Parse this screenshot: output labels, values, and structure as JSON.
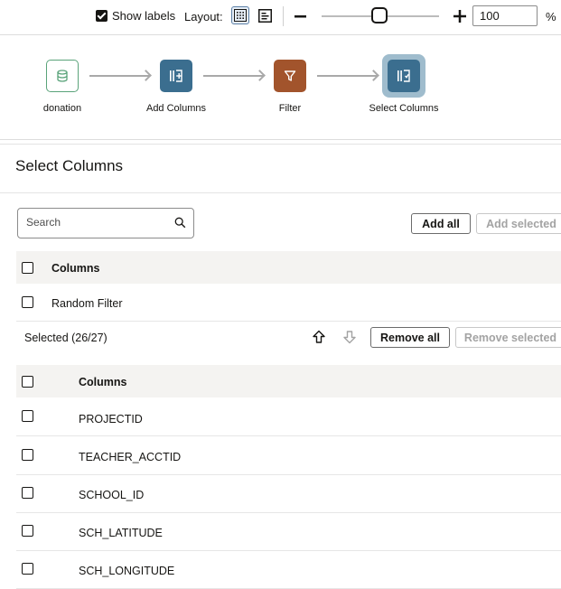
{
  "toolbar": {
    "show_labels": "Show labels",
    "show_labels_checked": true,
    "layout_label": "Layout:",
    "zoom_value": "100",
    "zoom_unit": "%",
    "zoom_minus_icon": "minus-icon",
    "zoom_plus_icon": "plus-icon"
  },
  "flow": {
    "nodes": [
      {
        "label": "donation",
        "icon": "database-icon",
        "color": "#5aa37a"
      },
      {
        "label": "Add Columns",
        "icon": "columns-icon",
        "color": "#3b6e8f"
      },
      {
        "label": "Filter",
        "icon": "filter-icon",
        "color": "#a2542c"
      },
      {
        "label": "Select Columns",
        "icon": "columns-select-icon",
        "color": "#3b6e8f"
      }
    ]
  },
  "panel": {
    "title": "Select Columns",
    "search_placeholder": "Search",
    "add_all": "Add all",
    "add_selected": "Add selected",
    "available_header": "Columns",
    "available_rows": [
      "Random Filter"
    ],
    "selected_label": "Selected (26/27)",
    "remove_all": "Remove all",
    "remove_selected": "Remove selected",
    "selected_header": "Columns",
    "selected_rows": [
      "PROJECTID",
      "TEACHER_ACCTID",
      "SCHOOL_ID",
      "SCH_LATITUDE",
      "SCH_LONGITUDE"
    ]
  }
}
